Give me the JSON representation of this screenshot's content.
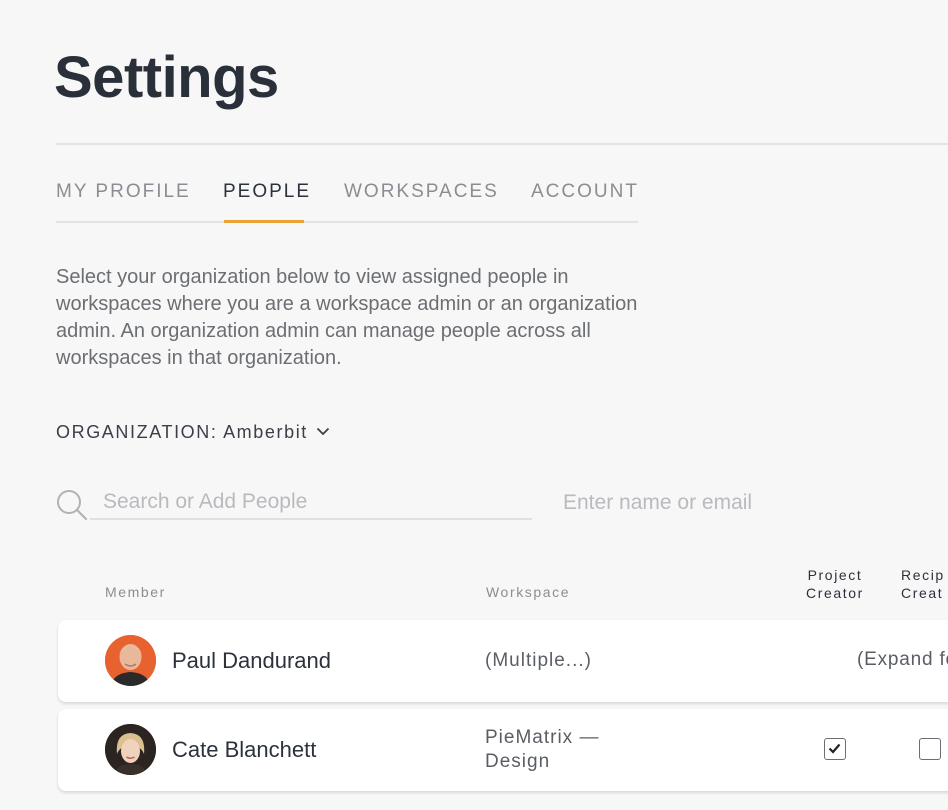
{
  "page": {
    "title": "Settings"
  },
  "tabs": [
    {
      "label": "MY PROFILE",
      "active": false
    },
    {
      "label": "PEOPLE",
      "active": true
    },
    {
      "label": "WORKSPACES",
      "active": false
    },
    {
      "label": "ACCOUNT",
      "active": false
    }
  ],
  "description": "Select your organization below to view assigned people in workspaces where you are a workspace admin or an organization admin. An organization admin can manage people across all workspaces in that organization.",
  "organization": {
    "label": "ORGANIZATION: Amberbit",
    "icon": "chevron-down-icon"
  },
  "search": {
    "placeholder": "Search or Add People",
    "hint": "Enter name or email",
    "icon": "search-icon"
  },
  "columns": {
    "member": "Member",
    "workspace": "Workspace",
    "project_creator_1": "Project",
    "project_creator_2": "Creator",
    "recipe_creator_1": "Recip",
    "recipe_creator_2": "Creat"
  },
  "members": [
    {
      "name": "Paul Dandurand",
      "workspace": "(Multiple...)",
      "permissions": "(Expand fo",
      "avatar_bg": "#e8622f"
    },
    {
      "name": "Cate Blanchett",
      "workspace_1": "PieMatrix —",
      "workspace_2": "Design",
      "project_creator": true,
      "recipe_creator": false,
      "avatar_bg": "#2b2420"
    }
  ],
  "colors": {
    "accent": "#e9a233",
    "text": "#2c323c",
    "muted": "#8a8d92"
  }
}
